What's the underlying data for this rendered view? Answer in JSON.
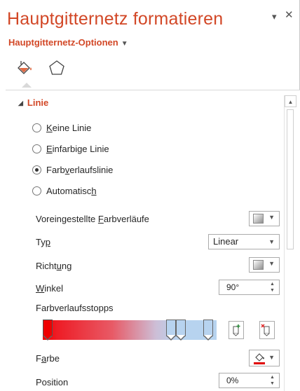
{
  "pane": {
    "title": "Hauptgitternetz formatieren",
    "menu_glyph": "▾",
    "close_glyph": "✕",
    "options_label": "Hauptgitternetz-Optionen",
    "options_caret": "▼"
  },
  "section": {
    "label": "Linie",
    "toggle": "◢"
  },
  "radios": [
    {
      "pre": "",
      "key": "K",
      "post": "eine Linie",
      "checked": false
    },
    {
      "pre": "",
      "key": "E",
      "post": "infarbige Linie",
      "checked": false
    },
    {
      "pre": "Farb",
      "key": "v",
      "post": "erlaufslinie",
      "checked": true
    },
    {
      "pre": "Automatisc",
      "key": "h",
      "post": "",
      "checked": false
    }
  ],
  "fields": {
    "preset": {
      "pre": "Voreingestellte ",
      "key": "F",
      "post": "arbverläufe"
    },
    "type": {
      "pre": "Ty",
      "key": "p",
      "post": "",
      "value": "Linear"
    },
    "direction": {
      "pre": "Richt",
      "key": "u",
      "post": "ng"
    },
    "angle": {
      "pre": "",
      "key": "W",
      "post": "inkel",
      "value": "90°"
    },
    "stops_label": "Farbverlaufsstopps",
    "color": {
      "pre": "F",
      "key": "a",
      "post": "rbe"
    },
    "position": {
      "label": "Position",
      "value": "0%"
    }
  },
  "gradient": {
    "stops": [
      {
        "position": 0,
        "color": "#ee0000",
        "selected": true
      },
      {
        "position": 75,
        "color": "#b7d3ef",
        "selected": false
      },
      {
        "position": 81,
        "color": "#b7d3ef",
        "selected": false
      },
      {
        "position": 98,
        "color": "#b7d3ef",
        "selected": false
      }
    ]
  },
  "colors": {
    "accent": "#d24726",
    "gradient_start": "#ee0000",
    "gradient_end": "#b7d3ef",
    "outline_color_bar": "#e00000"
  },
  "icons": {
    "fill_line_tab": "fill-and-line-icon",
    "effects_tab": "pentagon-icon",
    "add_stop": "add-gradient-stop-icon",
    "remove_stop": "remove-gradient-stop-icon",
    "outline_color": "paint-bucket-icon"
  },
  "dropdown_glyph": "▼",
  "spin_up": "▲",
  "spin_down": "▼"
}
